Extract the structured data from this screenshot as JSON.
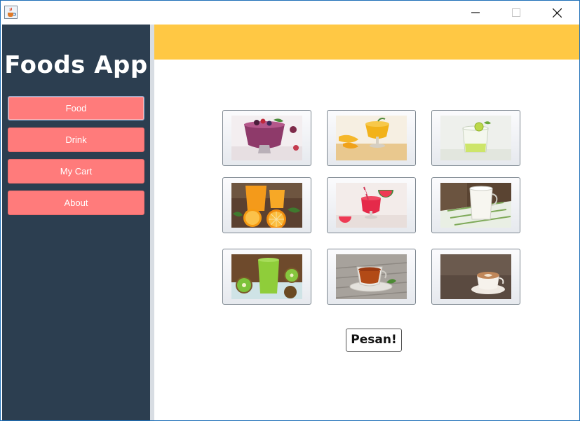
{
  "app": {
    "title": "Foods App"
  },
  "sidebar": {
    "items": [
      {
        "label": "Food"
      },
      {
        "label": "Drink"
      },
      {
        "label": "My Cart"
      },
      {
        "label": "About"
      }
    ]
  },
  "menu_grid": {
    "tiles": [
      {
        "icon": "berry-smoothie-photo"
      },
      {
        "icon": "mango-pudding-photo"
      },
      {
        "icon": "lime-soda-photo"
      },
      {
        "icon": "orange-juice-photo"
      },
      {
        "icon": "watermelon-juice-photo"
      },
      {
        "icon": "milk-glass-photo"
      },
      {
        "icon": "kiwi-smoothie-photo"
      },
      {
        "icon": "tea-cup-photo"
      },
      {
        "icon": "latte-art-photo"
      }
    ]
  },
  "actions": {
    "order_label": "Pesan!"
  },
  "colors": {
    "sidebar": "#2c3e50",
    "nav_button": "#ff7b7b",
    "header_bar": "#ffc844",
    "window_border": "#1e6fb8"
  }
}
